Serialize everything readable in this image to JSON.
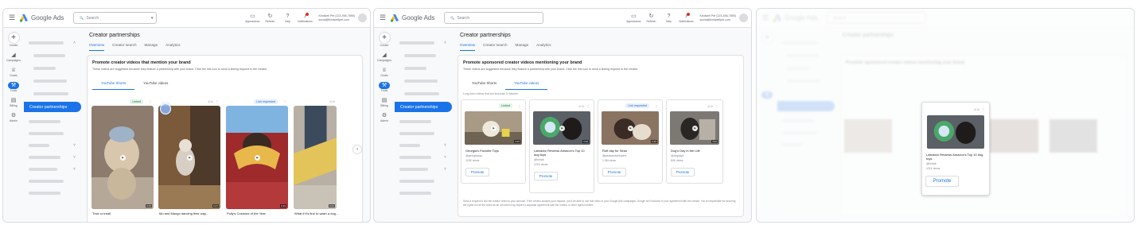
{
  "app": {
    "product_name": "Google Ads",
    "search_placeholder": "Search",
    "tools": [
      "Appearance",
      "Refresh",
      "Help",
      "Notifications"
    ],
    "account_line1": "Kindwell Pet (123-456-7890)",
    "account_line2": "social@kindwellpet.com"
  },
  "rail": {
    "items": [
      {
        "label": "Create",
        "icon": "plus-icon"
      },
      {
        "label": "Campaigns",
        "icon": "megaphone-icon"
      },
      {
        "label": "Goals",
        "icon": "trophy-icon"
      },
      {
        "label": "Tools",
        "icon": "tools-icon"
      },
      {
        "label": "Billing",
        "icon": "card-icon"
      },
      {
        "label": "Admin",
        "icon": "gear-icon"
      }
    ]
  },
  "subnav": {
    "active_label": "Creator partnerships"
  },
  "page": {
    "title": "Creator partnerships",
    "tabs": [
      "Overview",
      "Creator search",
      "Manage",
      "Analytics"
    ]
  },
  "panel1": {
    "card_title": "Promote creator videos that mention your brand",
    "card_desc": "These videos are suggested because they feature a partnership with your brand. Click the link icon to send a linking request to the creator.",
    "subtabs": [
      "YouTube Shorts",
      "YouTube videos"
    ],
    "videos": [
      {
        "title": "Trick or treat!",
        "status": "Linked",
        "duration": "0:15"
      },
      {
        "title": "Mo and Mango dancing their way...",
        "status": "",
        "duration": "0:27"
      },
      {
        "title": "Polly's Costume of the Year",
        "status": "Link requested",
        "duration": "0:19"
      },
      {
        "title": "What if it's fine to wash a dog...",
        "status": "",
        "duration": "0:21"
      }
    ]
  },
  "panel2": {
    "card_title": "Promote sponsored creator videos mentioning your brand",
    "card_desc": "These videos are suggested because they feature a partnership with your brand. Click the link icon to send a linking request to the creator.",
    "subtabs": [
      "YouTube Shorts",
      "YouTube videos"
    ],
    "note": "Long-form videos that are less than 5 minutes",
    "videos": [
      {
        "title": "Georgia's Favorite Toys",
        "channel": "@georgiatoys",
        "views": "220K views",
        "status": "Linked",
        "duration": "3:15",
        "button": "Promote"
      },
      {
        "title": "Labrador Reviews Amazon's Top 10 dog toys",
        "channel": "@bcrlab",
        "views": "121K views",
        "status": "",
        "duration": "4:32",
        "button": "Promote"
      },
      {
        "title": "Ruff day for Sean",
        "channel": "@pawsandwhiskers",
        "views": "1.9M views",
        "status": "Link requested",
        "duration": "2:45",
        "button": "Promote"
      },
      {
        "title": "Dog's Day in the Life",
        "channel": "@dogdayz",
        "views": "84K views",
        "status": "",
        "duration": "3:02",
        "button": "Promote"
      }
    ],
    "footer": "Send a request to link the creator video to your account. If the creator accepts your request, you'll be able to use that video in your Google Ads campaigns. Google isn't involved in your agreement with the creator. You're responsible for securing the rights to use the video as an ad which may require a separate agreement with the creator or other rights holders."
  },
  "panel3": {
    "highlight": {
      "title": "Labrador Reviews Amazon's Top 10 dog toys",
      "channel": "@bcrlab",
      "views": "121K views",
      "button": "Promote"
    }
  },
  "colors": {
    "accent": "#1a73e8",
    "linked": "#137333",
    "requested": "#1967d2",
    "alert": "#d93025"
  }
}
